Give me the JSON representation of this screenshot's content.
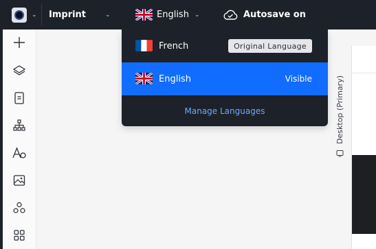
{
  "topbar": {
    "site_menu": {
      "icon": "site-logo-icon",
      "caret": "⌄"
    },
    "page_selector": {
      "label": "Imprint",
      "caret": "⌄"
    },
    "language_selector": {
      "flag": "uk-flag-icon",
      "label": "English",
      "caret": "⌄"
    },
    "autosave": {
      "icon": "cloud-check-icon",
      "label": "Autosave on"
    }
  },
  "language_dropdown": {
    "items": [
      {
        "flag": "france-flag-icon",
        "label": "French",
        "badge": "Original Language",
        "status": "",
        "active": false
      },
      {
        "flag": "uk-flag-icon",
        "label": "English",
        "badge": "",
        "status": "Visible",
        "active": true
      }
    ],
    "manage_label": "Manage Languages"
  },
  "left_rail": {
    "icons": [
      "add-icon",
      "layers-icon",
      "pages-icon",
      "sitemap-icon",
      "text-theme-icon",
      "media-icon",
      "apps-icon",
      "app-market-icon"
    ]
  },
  "canvas": {
    "frame_label": "Desktop (Primary)",
    "frame_icon": "device-icon"
  },
  "colors": {
    "topbar_bg": "#1d2129",
    "accent": "#116dff",
    "link": "#6ea8ff",
    "canvas_bg": "#f5f5f6"
  }
}
